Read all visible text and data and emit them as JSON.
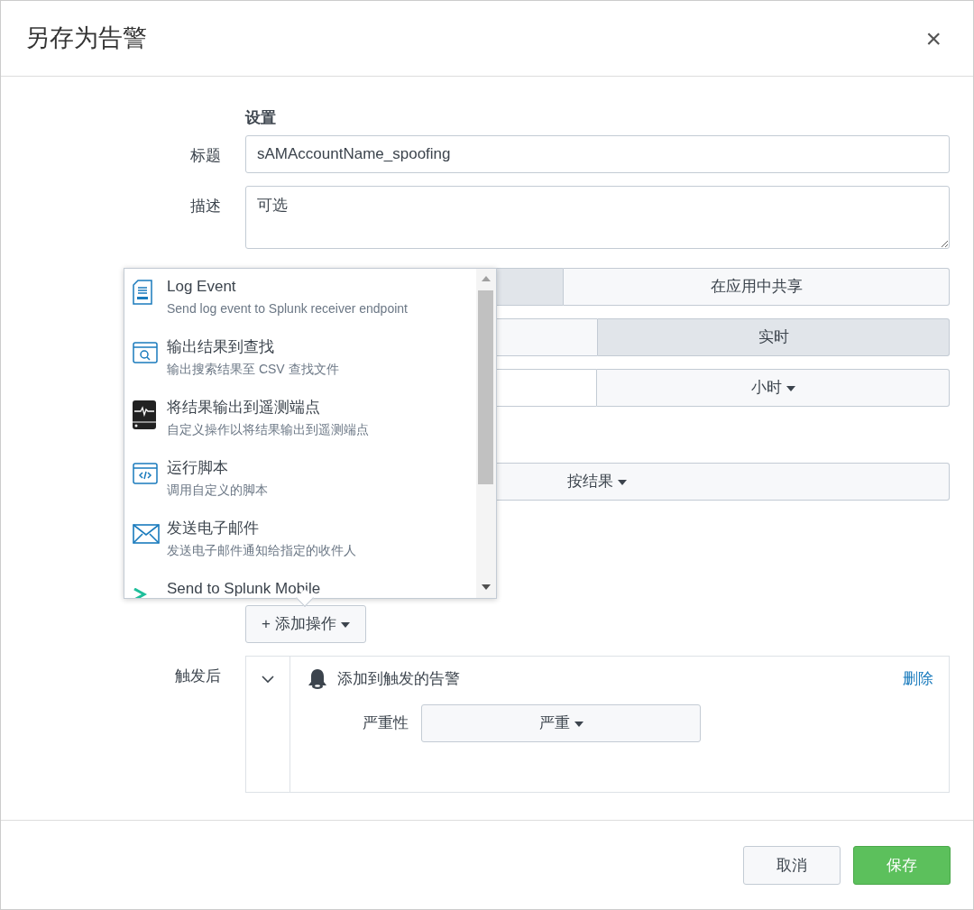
{
  "dialog": {
    "title": "另存为告警",
    "close": "×"
  },
  "settings": {
    "heading": "设置",
    "title_field": {
      "label": "标题",
      "value": "sAMAccountName_spoofing"
    },
    "description_field": {
      "label": "描述",
      "placeholder": "可选"
    },
    "permissions": [
      {
        "selected": true
      },
      {
        "label": "在应用中共享",
        "selected": false
      }
    ],
    "alert_type": [
      {
        "selected": false
      },
      {
        "label": "实时",
        "selected": true
      }
    ],
    "schedule": {
      "unit": "小时"
    },
    "trigger": {
      "value": "按结果"
    }
  },
  "add_action_button": "+ 添加操作",
  "actions_menu": [
    {
      "kind": "log",
      "title": "Log Event",
      "description": "Send log event to Splunk receiver endpoint"
    },
    {
      "kind": "lookup",
      "title": "输出结果到查找",
      "description": "输出搜索结果至 CSV 查找文件"
    },
    {
      "kind": "telemetry",
      "title": "将结果输出到遥测端点",
      "description": "自定义操作以将结果输出到遥测端点"
    },
    {
      "kind": "script",
      "title": "运行脚本",
      "description": "调用自定义的脚本"
    },
    {
      "kind": "email",
      "title": "发送电子邮件",
      "description": "发送电子邮件通知给指定的收件人"
    },
    {
      "kind": "mobile",
      "title": "Send to Splunk Mobile"
    }
  ],
  "after_trigger": {
    "label": "触发后",
    "action": {
      "title": "添加到触发的告警",
      "expanded": true,
      "delete": "删除",
      "severity_label": "严重性",
      "severity": "严重"
    }
  },
  "footer": {
    "cancel": "取消",
    "save": "保存"
  }
}
